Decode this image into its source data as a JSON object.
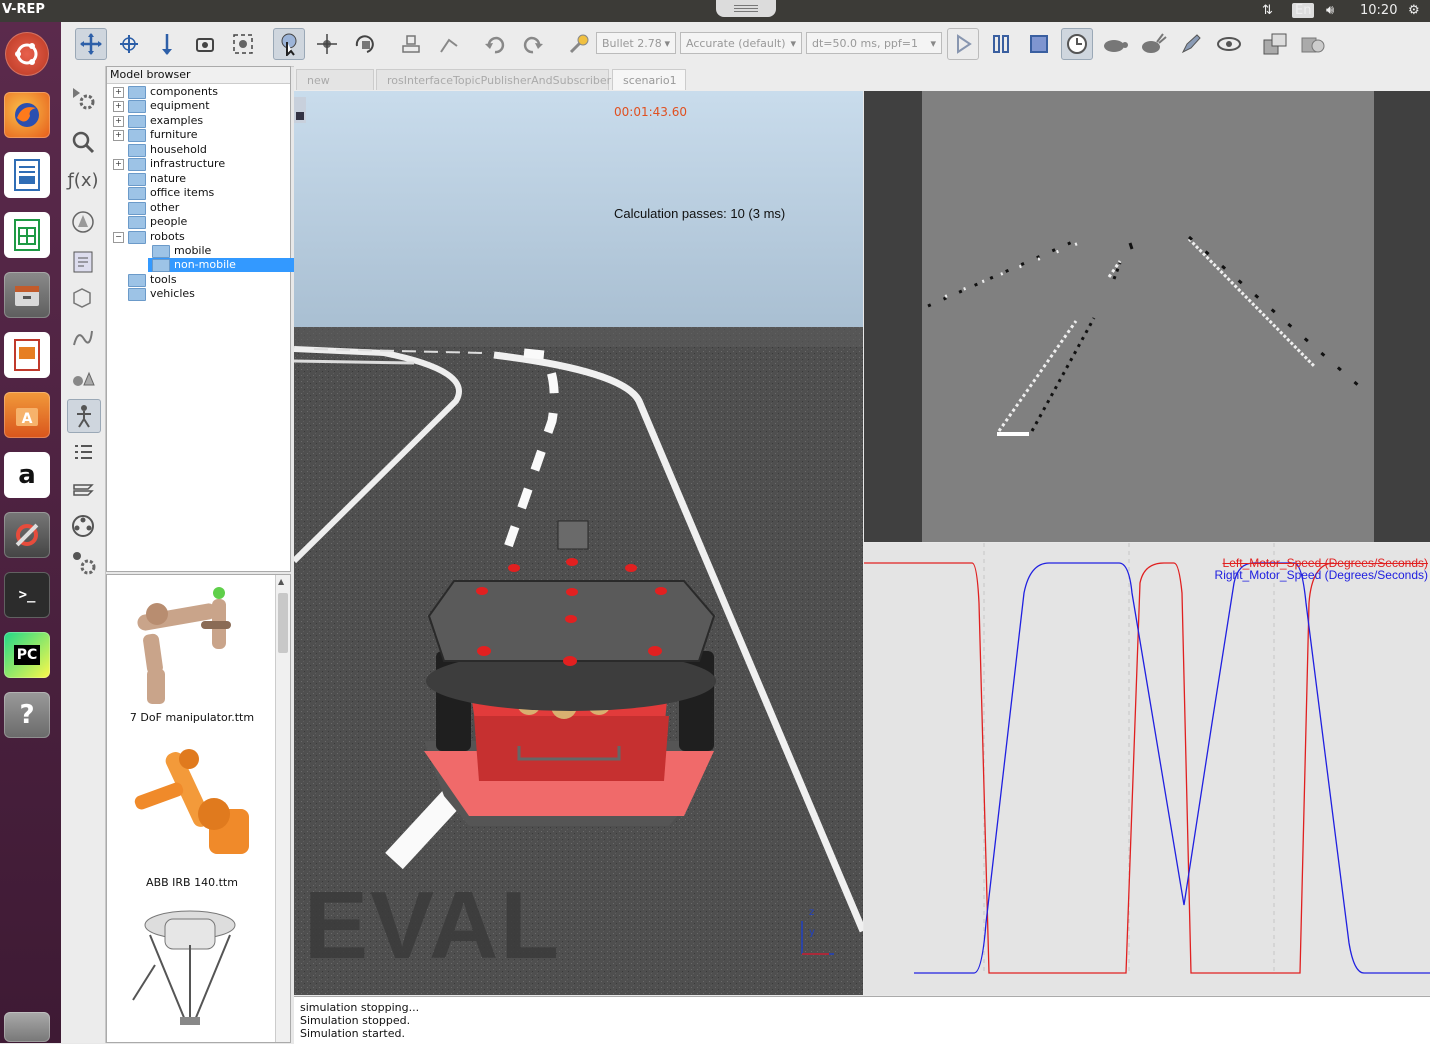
{
  "app": {
    "title": "V-REP"
  },
  "system_tray": {
    "lang": "En",
    "time": "10:20"
  },
  "launcher": {
    "items": [
      {
        "name": "ubuntu-dash-icon"
      },
      {
        "name": "firefox-icon"
      },
      {
        "name": "libreoffice-writer-icon"
      },
      {
        "name": "libreoffice-calc-icon"
      },
      {
        "name": "files-icon"
      },
      {
        "name": "libreoffice-impress-icon"
      },
      {
        "name": "software-center-icon"
      },
      {
        "name": "amazon-icon",
        "glyph": "a"
      },
      {
        "name": "system-settings-icon"
      },
      {
        "name": "terminal-icon",
        "glyph": ">_"
      },
      {
        "name": "pycharm-icon",
        "glyph": "PC"
      },
      {
        "name": "help-icon",
        "glyph": "?"
      },
      {
        "name": "trash-icon"
      }
    ]
  },
  "toolbar": {
    "engine": "Bullet 2.78",
    "accuracy": "Accurate (default)",
    "timestep": "dt=50.0 ms, ppf=1"
  },
  "model_browser": {
    "header": "Model browser",
    "items": [
      {
        "label": "components",
        "expander": "+"
      },
      {
        "label": "equipment",
        "expander": "+"
      },
      {
        "label": "examples",
        "expander": "+"
      },
      {
        "label": "furniture",
        "expander": "+"
      },
      {
        "label": "household",
        "expander": ""
      },
      {
        "label": "infrastructure",
        "expander": "+"
      },
      {
        "label": "nature",
        "expander": ""
      },
      {
        "label": "office items",
        "expander": ""
      },
      {
        "label": "other",
        "expander": ""
      },
      {
        "label": "people",
        "expander": ""
      },
      {
        "label": "robots",
        "expander": "−"
      },
      {
        "label": "mobile",
        "expander": "",
        "child": true
      },
      {
        "label": "non-mobile",
        "expander": "",
        "child": true,
        "selected": true
      },
      {
        "label": "tools",
        "expander": ""
      },
      {
        "label": "vehicles",
        "expander": ""
      }
    ]
  },
  "thumbnails": [
    {
      "label": "7 DoF manipulator.ttm"
    },
    {
      "label": "ABB IRB 140.ttm"
    }
  ],
  "tabs": [
    {
      "label": "new scene"
    },
    {
      "label": "rosInterfaceTopicPublisherAndSubscriber"
    },
    {
      "label": "scenario1",
      "active": true
    }
  ],
  "scene": {
    "timer": "00:01:43.60",
    "calc_passes": "Calculation passes: 10 (3 ms)",
    "watermark": "EVAL",
    "axis_z": "z",
    "axis_y": "y"
  },
  "graph": {
    "legend_left": "Left_Motor_Speed (Degrees/Seconds)",
    "legend_right": "Right_Motor_Speed (Degrees/Seconds)",
    "left_color": "#e02020",
    "right_color": "#2020e0"
  },
  "status": {
    "lines": [
      "simulation stopping...",
      "Simulation stopped.",
      "Simulation started."
    ]
  }
}
